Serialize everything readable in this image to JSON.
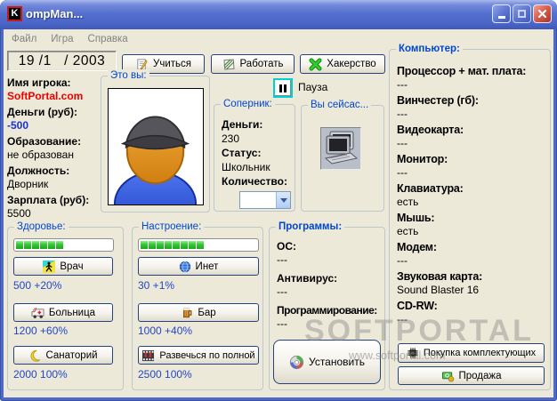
{
  "window": {
    "icon_letter": "K",
    "title": "ompMan..."
  },
  "menu": {
    "items": [
      {
        "label": "Файл"
      },
      {
        "label": "Игра"
      },
      {
        "label": "Справка"
      }
    ]
  },
  "toolbar": {
    "date": "19 /1   / 2003",
    "study": "Учиться",
    "work": "Работать",
    "hacking": "Хакерство",
    "pause": "Пауза"
  },
  "player": {
    "items": [
      {
        "label": "Имя игрока:",
        "value": "SoftPortal.com"
      },
      {
        "label": "Деньги (руб):",
        "value": "-500"
      },
      {
        "label": "Образование:",
        "value": "не образован"
      },
      {
        "label": "Должность:",
        "value": "Дворник"
      },
      {
        "label": "Зарплата (руб):",
        "value": "5500"
      }
    ]
  },
  "you_box": {
    "title": "Это вы:"
  },
  "opponent": {
    "title": "Соперник:",
    "rows": [
      {
        "label": "Деньги:",
        "value": "230"
      },
      {
        "label": "Статус:",
        "value": "Школьник"
      }
    ],
    "count_label": "Количество:",
    "count_value": ""
  },
  "now_box": {
    "title": "Вы сейсас..."
  },
  "health": {
    "title": "Здоровье:",
    "progress_filled": 6,
    "actions": [
      {
        "label": "Врач",
        "cost": "500 +20%"
      },
      {
        "label": "Больница",
        "cost": "1200 +60%"
      },
      {
        "label": "Санаторий",
        "cost": "2000 100%"
      }
    ]
  },
  "mood": {
    "title": "Настроение:",
    "progress_filled": 8,
    "actions": [
      {
        "label": "Инет",
        "cost": "30 +1%"
      },
      {
        "label": "Бар",
        "cost": "1000 +40%"
      },
      {
        "label": "Развечься по полной",
        "cost": "2500 100%"
      }
    ]
  },
  "programs": {
    "title": "Программы:",
    "items": [
      {
        "label": "ОС:",
        "value": "---"
      },
      {
        "label": "Антивирус:",
        "value": "---"
      },
      {
        "label": "Программирование:",
        "value": "---"
      }
    ],
    "install": "Установить"
  },
  "computer": {
    "title": "Компьютер:",
    "items": [
      {
        "label": "Процессор + мат. плата:",
        "value": "---"
      },
      {
        "label": "Винчестер (гб):",
        "value": "---"
      },
      {
        "label": "Видеокарта:",
        "value": "---"
      },
      {
        "label": "Монитор:",
        "value": "---"
      },
      {
        "label": "Клавиатура:",
        "value": "есть"
      },
      {
        "label": "Мышь:",
        "value": "есть"
      },
      {
        "label": "Модем:",
        "value": "---"
      },
      {
        "label": "Звуковая карта:",
        "value": "Sound Blaster 16"
      },
      {
        "label": "CD-RW:",
        "value": "---"
      }
    ],
    "buy": "Покупка комплектующих",
    "sell": "Продажа"
  },
  "watermark": {
    "big": "SOFTPORTAL",
    "small": "www.softportal.com"
  },
  "colors": {
    "caption_blue": "#0046D5",
    "cost_blue": "#2346C6",
    "money_blue": "#1A2FD8",
    "name_red": "#EE0000",
    "progress_green": "#2FC32F",
    "titlebar_blue": "#5571CE",
    "client_beige": "#ECE9D8"
  }
}
